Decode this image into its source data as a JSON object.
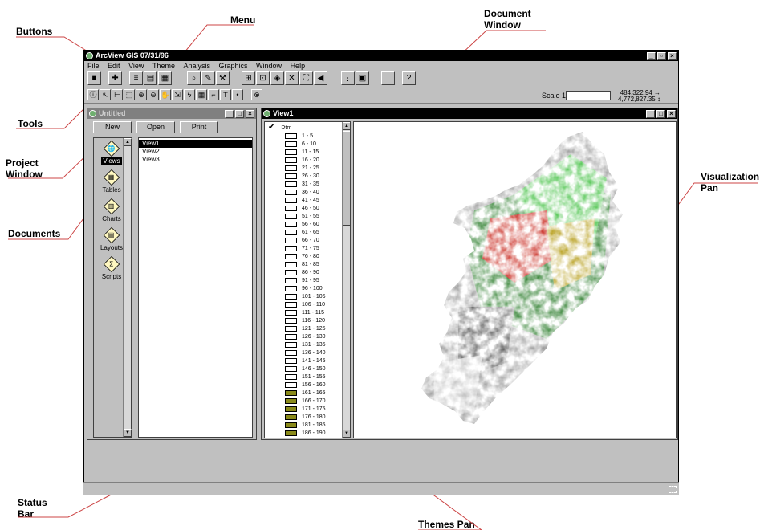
{
  "callouts": {
    "buttons": "Buttons",
    "menu": "Menu",
    "document_window": "Document Window",
    "tools": "Tools",
    "project_window": "Project Window",
    "documents": "Documents",
    "visualization_pan": "Visualization Pan",
    "status_bar": "Status Bar",
    "themes_pan": "Themes Pan"
  },
  "app": {
    "title": "ArcView GIS 07/31/96",
    "menu": [
      "File",
      "Edit",
      "View",
      "Theme",
      "Analysis",
      "Graphics",
      "Window",
      "Help"
    ],
    "scale_label": "Scale 1:",
    "scale_value": "",
    "coord_x": "484,322.94",
    "coord_y": "4,772,827.35",
    "coord_x_arrows": "↔",
    "coord_y_arrows": "↕"
  },
  "toolbar_buttons": [
    "save-icon",
    "add-theme-icon",
    "theme-properties-icon",
    "edit-legend-icon",
    "table-icon",
    "find-icon",
    "locate-icon",
    "query-icon",
    "zoom-full-icon",
    "zoom-active-icon",
    "zoom-selected-icon",
    "zoom-in-icon",
    "zoom-out-icon",
    "zoom-previous-icon",
    "clear-selection-icon",
    "select-all-icon",
    "layout-icon",
    "help-icon"
  ],
  "tools": [
    "identify-icon",
    "pointer-icon",
    "vertex-icon",
    "select-feature-icon",
    "zoom-in-tool-icon",
    "zoom-out-tool-icon",
    "pan-icon",
    "measure-icon",
    "hotlink-icon",
    "area-of-interest-icon",
    "label-icon",
    "text-icon",
    "draw-point-icon",
    "snap-icon"
  ],
  "project": {
    "title": "Untitled",
    "buttons": {
      "new": "New",
      "open": "Open",
      "print": "Print"
    },
    "documents": [
      {
        "label": "Views",
        "icon": "globe-icon",
        "glyph": "🌐",
        "selected": true
      },
      {
        "label": "Tables",
        "icon": "table-doc-icon",
        "glyph": "▦",
        "selected": false
      },
      {
        "label": "Charts",
        "icon": "chart-doc-icon",
        "glyph": "▥",
        "selected": false
      },
      {
        "label": "Layouts",
        "icon": "layout-doc-icon",
        "glyph": "▤",
        "selected": false
      },
      {
        "label": "Scripts",
        "icon": "script-doc-icon",
        "glyph": "Σ",
        "selected": false
      }
    ],
    "views": [
      "View1",
      "View2",
      "View3"
    ]
  },
  "view_window": {
    "title": "View1",
    "theme_name": "Dtm",
    "theme_visible": true,
    "legend": [
      {
        "label": "1 - 5",
        "color": "#ffffff"
      },
      {
        "label": "6 - 10",
        "color": "#ffffff"
      },
      {
        "label": "11 - 15",
        "color": "#ffffff"
      },
      {
        "label": "16 - 20",
        "color": "#ffffff"
      },
      {
        "label": "21 - 25",
        "color": "#ffffff"
      },
      {
        "label": "26 - 30",
        "color": "#ffffff"
      },
      {
        "label": "31 - 35",
        "color": "#ffffff"
      },
      {
        "label": "36 - 40",
        "color": "#ffffff"
      },
      {
        "label": "41 - 45",
        "color": "#ffffff"
      },
      {
        "label": "46 - 50",
        "color": "#ffffff"
      },
      {
        "label": "51 - 55",
        "color": "#ffffff"
      },
      {
        "label": "56 - 60",
        "color": "#ffffff"
      },
      {
        "label": "61 - 65",
        "color": "#ffffff"
      },
      {
        "label": "66 - 70",
        "color": "#ffffff"
      },
      {
        "label": "71 - 75",
        "color": "#ffffff"
      },
      {
        "label": "76 - 80",
        "color": "#ffffff"
      },
      {
        "label": "81 - 85",
        "color": "#ffffff"
      },
      {
        "label": "86 - 90",
        "color": "#ffffff"
      },
      {
        "label": "91 - 95",
        "color": "#ffffff"
      },
      {
        "label": "96 - 100",
        "color": "#ffffff"
      },
      {
        "label": "101 - 105",
        "color": "#ffffff"
      },
      {
        "label": "106 - 110",
        "color": "#ffffff"
      },
      {
        "label": "111 - 115",
        "color": "#ffffff"
      },
      {
        "label": "116 - 120",
        "color": "#ffffff"
      },
      {
        "label": "121 - 125",
        "color": "#ffffff"
      },
      {
        "label": "126 - 130",
        "color": "#ffffff"
      },
      {
        "label": "131 - 135",
        "color": "#ffffff"
      },
      {
        "label": "136 - 140",
        "color": "#ffffff"
      },
      {
        "label": "141 - 145",
        "color": "#ffffff"
      },
      {
        "label": "146 - 150",
        "color": "#ffffff"
      },
      {
        "label": "151 - 155",
        "color": "#ffffff"
      },
      {
        "label": "156 - 160",
        "color": "#ffffff"
      },
      {
        "label": "161 - 165",
        "color": "#8a8a1a"
      },
      {
        "label": "166 - 170",
        "color": "#8a8a1a"
      },
      {
        "label": "171 - 175",
        "color": "#8a8a1a"
      },
      {
        "label": "176 - 180",
        "color": "#8a8a1a"
      },
      {
        "label": "181 - 185",
        "color": "#8a8a1a"
      },
      {
        "label": "186 - 190",
        "color": "#8a8a1a"
      },
      {
        "label": "191 - 195",
        "color": "#8a8a1a"
      }
    ]
  },
  "colors": {
    "window_face": "#c0c0c0",
    "active_title": "#000000",
    "inactive_title": "#808080",
    "relief_green": "#3fbf3f",
    "relief_red": "#c8281e",
    "relief_gray": "#9a9a9a"
  }
}
